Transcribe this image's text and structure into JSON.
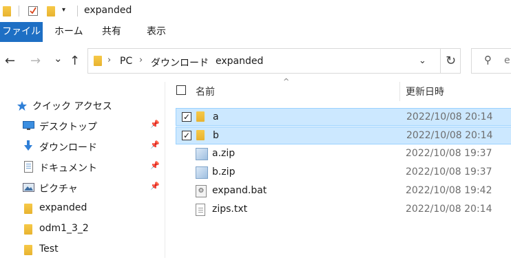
{
  "window": {
    "title": "expanded",
    "quick_access_dropdown": "▾"
  },
  "ribbon": {
    "tabs": [
      "ファイル",
      "ホーム",
      "共有",
      "表示"
    ]
  },
  "nav": {
    "back": "←",
    "forward": "→",
    "recent": "⌄",
    "up": "↑"
  },
  "address": {
    "crumbs": [
      "PC",
      "ダウンロード",
      "expanded"
    ],
    "separator": "›",
    "dropdown": "⌄",
    "refresh": "↻"
  },
  "search": {
    "icon": "⚲",
    "text": "e"
  },
  "sidebar": {
    "quick_access_label": "クイック アクセス",
    "items": [
      {
        "label": "デスクトップ",
        "pinned": true,
        "icon": "desktop-icon"
      },
      {
        "label": "ダウンロード",
        "pinned": true,
        "icon": "download-icon"
      },
      {
        "label": "ドキュメント",
        "pinned": true,
        "icon": "documents-icon"
      },
      {
        "label": "ピクチャ",
        "pinned": true,
        "icon": "pictures-icon"
      },
      {
        "label": "expanded",
        "pinned": false,
        "icon": "folder-icon"
      },
      {
        "label": "odm1_3_2",
        "pinned": false,
        "icon": "folder-icon"
      },
      {
        "label": "Test",
        "pinned": false,
        "icon": "folder-icon"
      }
    ]
  },
  "columns": {
    "name": "名前",
    "date": "更新日時",
    "sort_indicator": "^"
  },
  "files": [
    {
      "name": "a",
      "date": "2022/10/08 20:14",
      "type": "folder",
      "selected": true
    },
    {
      "name": "b",
      "date": "2022/10/08 20:14",
      "type": "folder",
      "selected": true
    },
    {
      "name": "a.zip",
      "date": "2022/10/08 19:37",
      "type": "zip",
      "selected": false
    },
    {
      "name": "b.zip",
      "date": "2022/10/08 19:37",
      "type": "zip",
      "selected": false
    },
    {
      "name": "expand.bat",
      "date": "2022/10/08 19:42",
      "type": "bat",
      "selected": false
    },
    {
      "name": "zips.txt",
      "date": "2022/10/08 20:14",
      "type": "txt",
      "selected": false
    }
  ],
  "colors": {
    "accent": "#1e6fc4",
    "selection": "#cce8ff",
    "selection_border": "#99d1ff",
    "folder": "#f1be3c"
  }
}
